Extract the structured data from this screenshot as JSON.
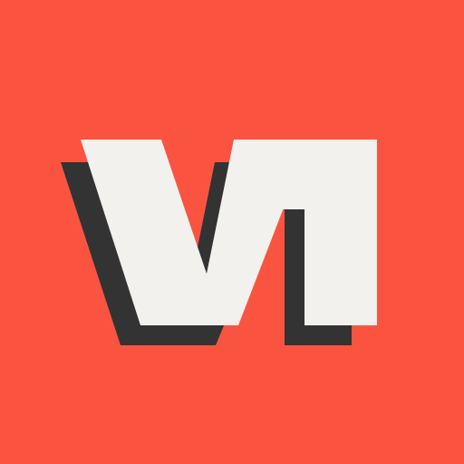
{
  "logo": {
    "text": "V1"
  },
  "colors": {
    "background": "#FA5441",
    "letter_fill": "#F3F1ED",
    "letter_shadow": "#333333"
  }
}
